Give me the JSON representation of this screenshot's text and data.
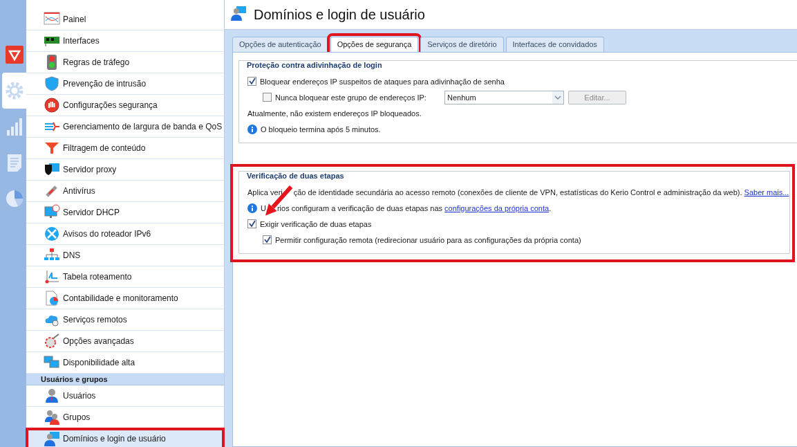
{
  "rail": [
    {
      "kind": "shield",
      "selected": false
    },
    {
      "kind": "gear",
      "selected": true
    },
    {
      "kind": "bars",
      "selected": false
    },
    {
      "kind": "doc",
      "selected": false
    },
    {
      "kind": "pie",
      "selected": false
    }
  ],
  "sidebar": {
    "items": [
      {
        "label": "Painel",
        "selected": false,
        "highlighted": false
      },
      {
        "label": "Interfaces",
        "selected": false,
        "highlighted": false
      },
      {
        "label": "Regras de tráfego",
        "selected": false,
        "highlighted": false
      },
      {
        "label": "Prevenção de intrusão",
        "selected": false,
        "highlighted": false
      },
      {
        "label": "Configurações segurança",
        "selected": false,
        "highlighted": false
      },
      {
        "label": "Gerenciamento de largura de banda e QoS",
        "selected": false,
        "highlighted": false
      },
      {
        "label": "Filtragem de conteúdo",
        "selected": false,
        "highlighted": false
      },
      {
        "label": "Servidor proxy",
        "selected": false,
        "highlighted": false
      },
      {
        "label": "Antivírus",
        "selected": false,
        "highlighted": false
      },
      {
        "label": "Servidor DHCP",
        "selected": false,
        "highlighted": false
      },
      {
        "label": "Avisos do roteador IPv6",
        "selected": false,
        "highlighted": false
      },
      {
        "label": "DNS",
        "selected": false,
        "highlighted": false
      },
      {
        "label": "Tabela roteamento",
        "selected": false,
        "highlighted": false
      },
      {
        "label": "Contabilidade e monitoramento",
        "selected": false,
        "highlighted": false
      },
      {
        "label": "Serviços remotos",
        "selected": false,
        "highlighted": false
      },
      {
        "label": "Opções avançadas",
        "selected": false,
        "highlighted": false
      },
      {
        "label": "Disponibilidade alta",
        "selected": false,
        "highlighted": false
      },
      {
        "kind": "header",
        "label": "Usuários e grupos"
      },
      {
        "label": "Usuários",
        "selected": false,
        "highlighted": false
      },
      {
        "label": "Grupos",
        "selected": false,
        "highlighted": false
      },
      {
        "label": "Domínios e login de usuário",
        "selected": true,
        "highlighted": true
      }
    ]
  },
  "page_title": "Domínios e login de usuário",
  "tabs": [
    {
      "label": "Opções de autenticação",
      "selected": false,
      "highlighted": false
    },
    {
      "label": "Opções de segurança",
      "selected": true,
      "highlighted": true
    },
    {
      "label": "Serviços de diretório",
      "selected": false,
      "highlighted": false
    },
    {
      "label": "Interfaces de convidados",
      "selected": false,
      "highlighted": false
    }
  ],
  "sections": [
    {
      "title": "Proteção contra adivinhação de login",
      "highlighted": false,
      "rows": [
        {
          "kind": "checkbox",
          "label": "Bloquear endereços IP suspeitos de ataques para adivinhação de senha",
          "checked": true,
          "children": [
            {
              "kind": "checkbox-select",
              "label": "Nunca bloquear este grupo de endereços IP:",
              "checked": false,
              "value": "Nenhum",
              "button": "Editar...",
              "button_disabled": true
            }
          ]
        },
        {
          "kind": "text",
          "text": "Atualmente, não existem endereços IP bloqueados."
        },
        {
          "kind": "info",
          "text": "O bloqueio termina após 5 minutos."
        }
      ]
    },
    {
      "title": "Verificação de duas etapas",
      "highlighted": true,
      "rows": [
        {
          "kind": "text",
          "parts": [
            "Aplica veri",
            "ção de identidade secundária ao acesso remoto (conexões de cliente de VPN, estatísticas do Kerio Control e administração da web)."
          ],
          "link": "Saber mais..."
        },
        {
          "kind": "info",
          "parts": [
            "U",
            "rios configuram a verificação de duas etapas nas"
          ],
          "link": "configurações da própria conta",
          "after": "."
        },
        {
          "kind": "checkbox",
          "label": "Exigir verificação de duas etapas",
          "checked": true,
          "children": [
            {
              "kind": "checkbox",
              "label": "Permitir configuração remota (redirecionar usuário para as configurações da própria conta)",
              "checked": true
            }
          ]
        }
      ]
    }
  ],
  "annotation": {
    "kind": "arrow"
  }
}
